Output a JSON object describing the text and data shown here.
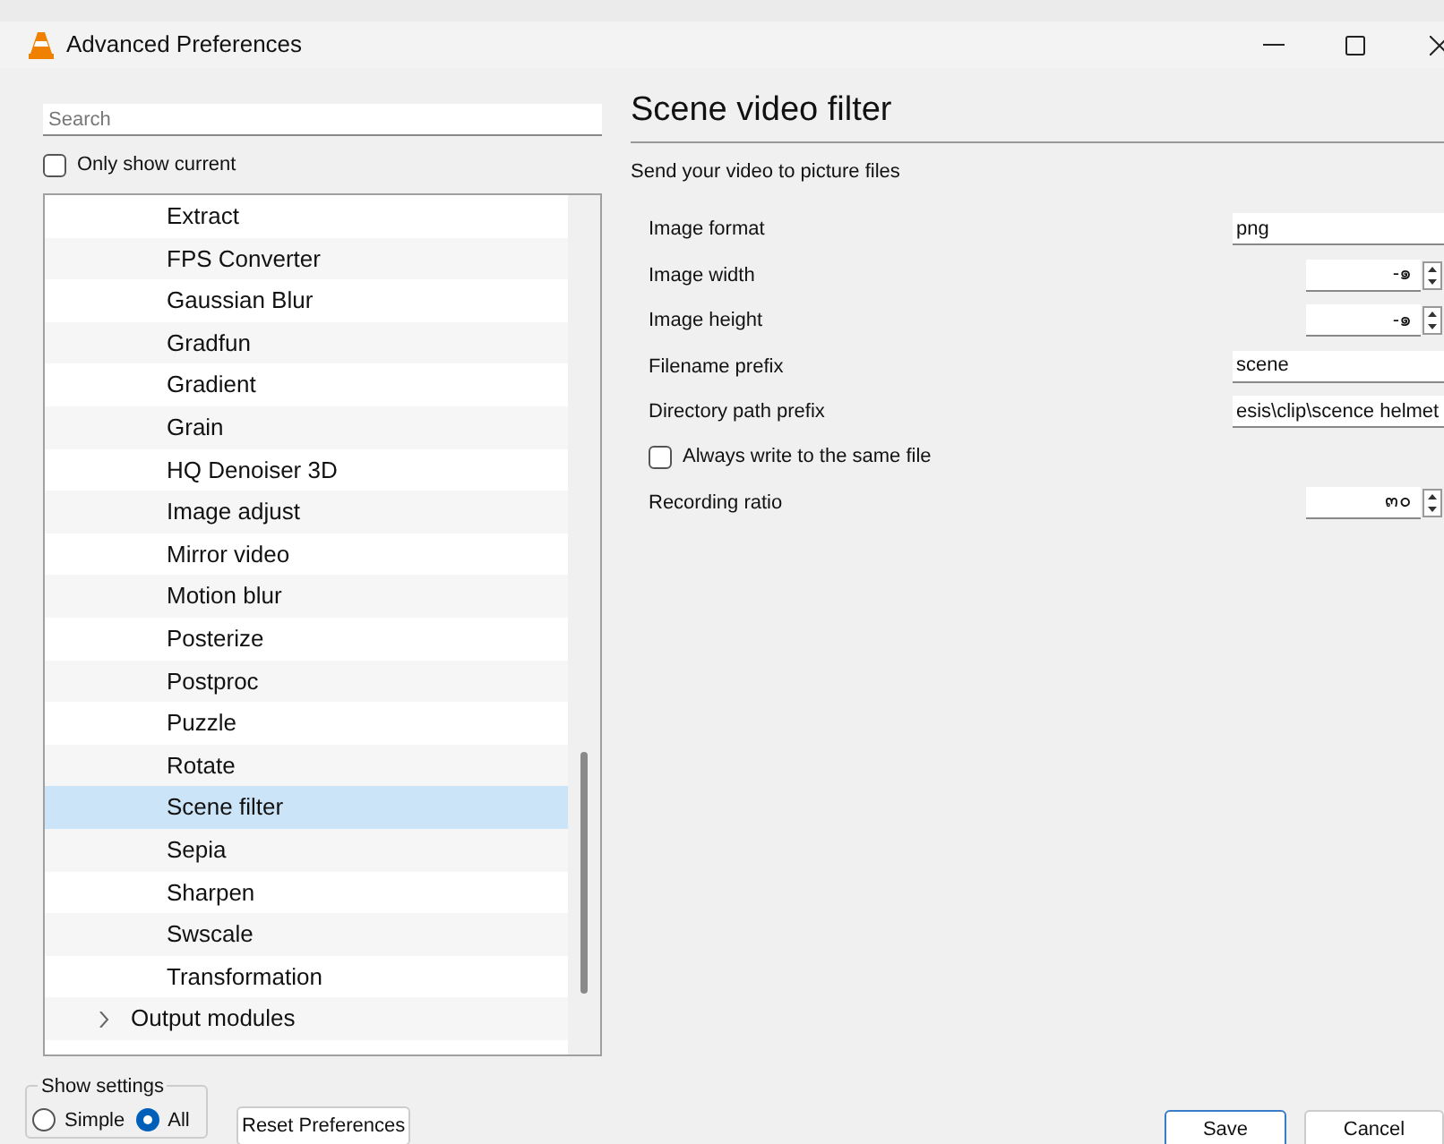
{
  "window": {
    "title": "Advanced Preferences"
  },
  "search": {
    "placeholder": "Search"
  },
  "only_show_current": {
    "label": "Only show current",
    "checked": false
  },
  "tree": [
    {
      "label": "Extract",
      "kind": "leaf",
      "selected": false
    },
    {
      "label": "FPS Converter",
      "kind": "leaf",
      "selected": false
    },
    {
      "label": "Gaussian Blur",
      "kind": "leaf",
      "selected": false
    },
    {
      "label": "Gradfun",
      "kind": "leaf",
      "selected": false
    },
    {
      "label": "Gradient",
      "kind": "leaf",
      "selected": false
    },
    {
      "label": "Grain",
      "kind": "leaf",
      "selected": false
    },
    {
      "label": "HQ Denoiser 3D",
      "kind": "leaf",
      "selected": false
    },
    {
      "label": "Image adjust",
      "kind": "leaf",
      "selected": false
    },
    {
      "label": "Mirror video",
      "kind": "leaf",
      "selected": false
    },
    {
      "label": "Motion blur",
      "kind": "leaf",
      "selected": false
    },
    {
      "label": "Posterize",
      "kind": "leaf",
      "selected": false
    },
    {
      "label": "Postproc",
      "kind": "leaf",
      "selected": false
    },
    {
      "label": "Puzzle",
      "kind": "leaf",
      "selected": false
    },
    {
      "label": "Rotate",
      "kind": "leaf",
      "selected": false
    },
    {
      "label": "Scene filter",
      "kind": "leaf",
      "selected": true
    },
    {
      "label": "Sepia",
      "kind": "leaf",
      "selected": false
    },
    {
      "label": "Sharpen",
      "kind": "leaf",
      "selected": false
    },
    {
      "label": "Swscale",
      "kind": "leaf",
      "selected": false
    },
    {
      "label": "Transformation",
      "kind": "leaf",
      "selected": false
    },
    {
      "label": "Output modules",
      "kind": "group",
      "selected": false,
      "expanded": false
    }
  ],
  "panel": {
    "title": "Scene video filter",
    "description": "Send your video to picture files"
  },
  "settings": [
    {
      "kind": "text",
      "label": "Image format",
      "value": "png"
    },
    {
      "kind": "spin",
      "label": "Image width",
      "value": "-๑"
    },
    {
      "kind": "spin",
      "label": "Image height",
      "value": "-๑"
    },
    {
      "kind": "text",
      "label": "Filename prefix",
      "value": "scene"
    },
    {
      "kind": "text",
      "label": "Directory path prefix",
      "value": "esis\\clip\\scence helmet"
    },
    {
      "kind": "check",
      "label": "Always write to the same file",
      "checked": false
    },
    {
      "kind": "spin",
      "label": "Recording ratio",
      "value": "๓๐"
    }
  ],
  "show_settings": {
    "title": "Show settings",
    "options": [
      {
        "label": "Simple",
        "selected": false
      },
      {
        "label": "All",
        "selected": true
      }
    ]
  },
  "buttons": [
    "Reset Preferences",
    "Save",
    "Cancel"
  ]
}
